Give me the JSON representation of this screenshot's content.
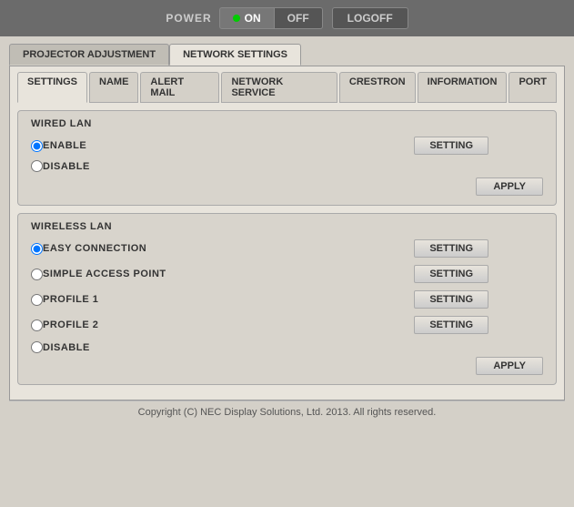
{
  "powerBar": {
    "powerLabel": "POWER",
    "onLabel": "ON",
    "offLabel": "OFF",
    "logoffLabel": "LOGOFF"
  },
  "tabs": {
    "primary": [
      {
        "id": "projector-adjustment",
        "label": "PROJECTOR ADJUSTMENT",
        "active": false
      },
      {
        "id": "network-settings",
        "label": "NETWORK SETTINGS",
        "active": true
      }
    ],
    "secondary": [
      {
        "id": "settings",
        "label": "SETTINGS",
        "active": true
      },
      {
        "id": "name",
        "label": "NAME",
        "active": false
      },
      {
        "id": "alert-mail",
        "label": "ALERT MAIL",
        "active": false
      },
      {
        "id": "network-service",
        "label": "NETWORK SERVICE",
        "active": false
      },
      {
        "id": "crestron",
        "label": "CRESTRON",
        "active": false
      },
      {
        "id": "information",
        "label": "INFORMATION",
        "active": false
      },
      {
        "id": "port",
        "label": "PORT",
        "active": false
      }
    ]
  },
  "wiredLan": {
    "title": "WIRED LAN",
    "options": [
      {
        "id": "wired-enable",
        "label": "ENABLE",
        "checked": true
      },
      {
        "id": "wired-disable",
        "label": "DISABLE",
        "checked": false
      }
    ],
    "settingLabel": "SETTING",
    "applyLabel": "APPLY"
  },
  "wirelessLan": {
    "title": "WIRELESS LAN",
    "options": [
      {
        "id": "wireless-easy",
        "label": "EASY CONNECTION",
        "checked": true,
        "hasSetting": true
      },
      {
        "id": "wireless-simple",
        "label": "SIMPLE ACCESS POINT",
        "checked": false,
        "hasSetting": true
      },
      {
        "id": "wireless-profile1",
        "label": "PROFILE 1",
        "checked": false,
        "hasSetting": true
      },
      {
        "id": "wireless-profile2",
        "label": "PROFILE 2",
        "checked": false,
        "hasSetting": true
      },
      {
        "id": "wireless-disable",
        "label": "DISABLE",
        "checked": false,
        "hasSetting": false
      }
    ],
    "settingLabel": "SETTING",
    "applyLabel": "APPLY"
  },
  "footer": {
    "text": "Copyright (C) NEC Display Solutions, Ltd. 2013. All rights reserved."
  }
}
